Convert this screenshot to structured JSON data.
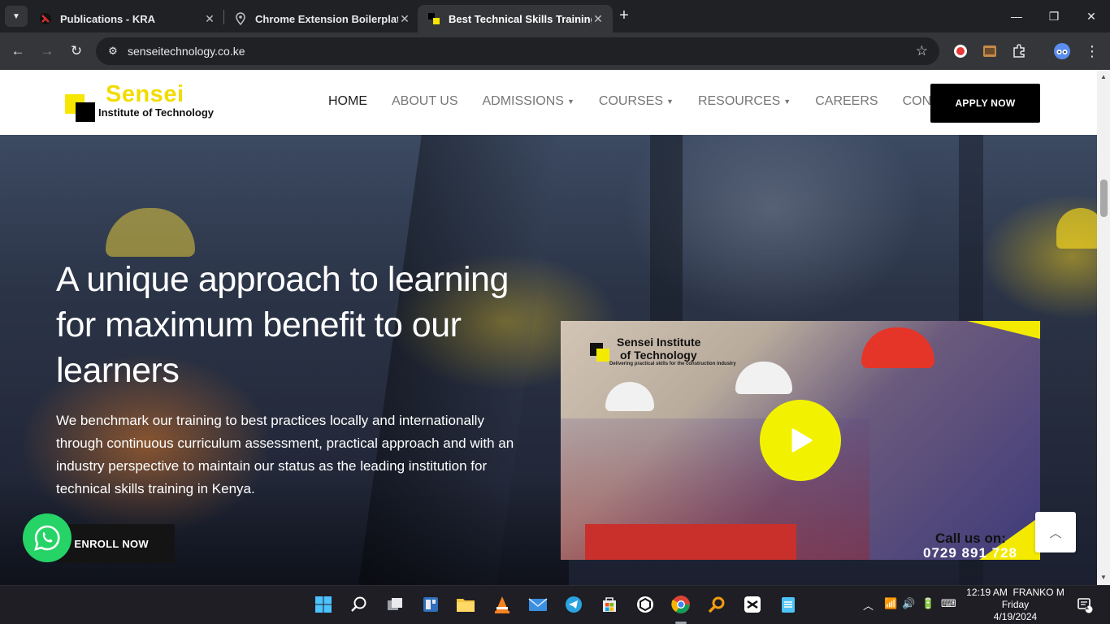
{
  "browser": {
    "tabs": [
      {
        "title": "Publications - KRA",
        "active": false
      },
      {
        "title": "Chrome Extension Boilerplate (",
        "active": false
      },
      {
        "title": "Best Technical Skills Training In",
        "active": true
      }
    ],
    "url": "senseitechnology.co.ke"
  },
  "site": {
    "logo": {
      "brand": "Sensei",
      "subtitle": "Institute of Technology"
    },
    "nav": [
      {
        "label": "HOME",
        "current": true,
        "dropdown": false
      },
      {
        "label": "ABOUT US",
        "current": false,
        "dropdown": false
      },
      {
        "label": "ADMISSIONS",
        "current": false,
        "dropdown": true
      },
      {
        "label": "COURSES",
        "current": false,
        "dropdown": true
      },
      {
        "label": "RESOURCES",
        "current": false,
        "dropdown": true
      },
      {
        "label": "CAREERS",
        "current": false,
        "dropdown": false
      },
      {
        "label": "CONTACTS",
        "current": false,
        "dropdown": false
      }
    ],
    "apply_label": "APPLY NOW"
  },
  "hero": {
    "title": "A unique approach to learning for maximum benefit to our learners",
    "text": "We benchmark our training to best practices locally and internationally through continuous curriculum assessment, practical approach and with an industry perspective to maintain our status as the leading institution for technical skills training in Kenya.",
    "enroll_label": "ENROLL NOW"
  },
  "video": {
    "brand_line1": "Sensei Institute",
    "brand_line2": "of Technology",
    "tagline": "Delivering practical skills for the construction industry",
    "call_label": "Call us on:",
    "phone": "0729 891 728"
  },
  "colors": {
    "brand_yellow": "#f7e600",
    "black": "#000000",
    "whatsapp_green": "#25d366"
  },
  "taskbar": {
    "time": "12:19 AM",
    "user": "FRANKO M",
    "day": "Friday",
    "date": "4/19/2024",
    "notification_count": "1"
  }
}
